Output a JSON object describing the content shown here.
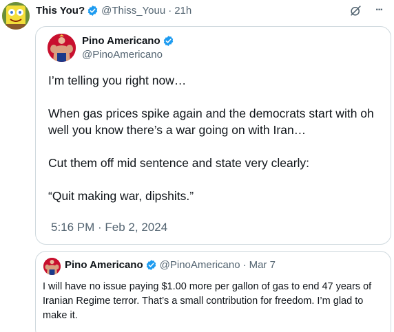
{
  "tweet": {
    "author": {
      "display_name": "This You?",
      "handle": "@Thiss_Youu",
      "avatar_icon": "spongebob-avatar-icon"
    },
    "time_ago": "21h",
    "separator": "·",
    "actions": {
      "grok_icon": "slash-circle-icon",
      "more_icon": "more-horizontal-icon",
      "more_glyph": "···"
    }
  },
  "quoted_tweet": {
    "author": {
      "display_name": "Pino Americano",
      "handle": "@PinoAmericano",
      "avatar_icon": "muscleman-avatar-icon"
    },
    "paragraphs": [
      "I’m telling you right now…",
      "When gas prices spike again and the democrats start with oh well you know there’s a war going on with Iran…",
      "Cut them off mid sentence and state very clearly:",
      "“Quit making war, dipshits.”"
    ],
    "timestamp": "5:16 PM · Feb 2, 2024"
  },
  "nested_quote": {
    "author": {
      "display_name": "Pino Americano",
      "handle": "@PinoAmericano",
      "avatar_icon": "muscleman-avatar-icon"
    },
    "separator": "·",
    "date": "Mar 7",
    "text": "I will have no issue paying $1.00 more per gallon of gas to end 47 years of Iranian Regime terror. That’s a small contribution for freedom. I’m glad to make it."
  },
  "colors": {
    "verified_blue": "#1d9bf0",
    "text_primary": "#0f1419",
    "text_secondary": "#536471",
    "border": "#cfd9de"
  }
}
